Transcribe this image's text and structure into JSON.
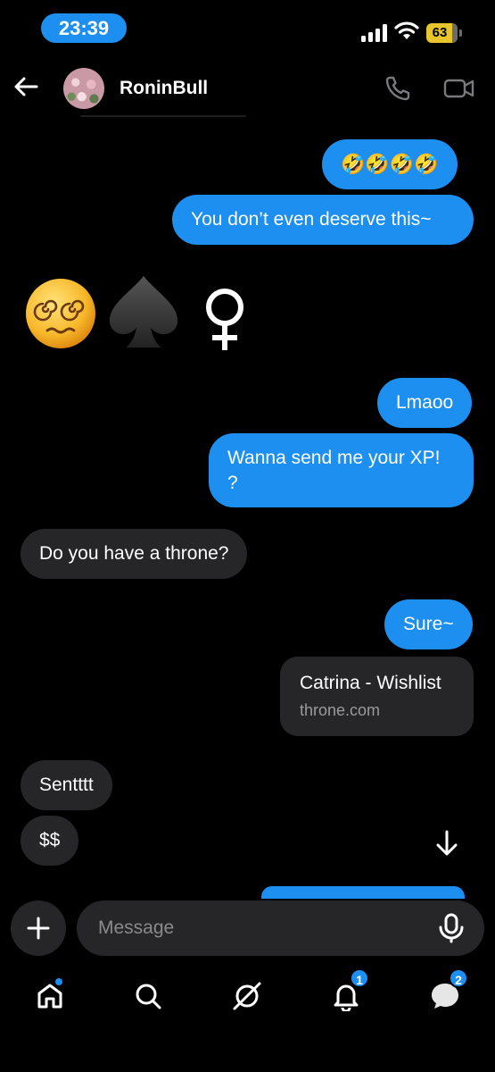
{
  "status_bar": {
    "time": "23:39",
    "battery": "63"
  },
  "header": {
    "contact_name": "RoninBull",
    "icons": [
      "back-arrow-icon",
      "phone-icon",
      "video-camera-icon"
    ]
  },
  "messages": [
    {
      "side": "sent",
      "text": "🤣🤣🤣🤣"
    },
    {
      "side": "sent",
      "text": "You don’t even deserve this~"
    },
    {
      "side": "received",
      "type": "emoji",
      "text": "😵‍💫♠️♀"
    },
    {
      "side": "sent",
      "text": "Lmaoo"
    },
    {
      "side": "sent",
      "text": "Wanna send me your XP!\n?"
    },
    {
      "side": "received",
      "text": "Do you have a throne?"
    },
    {
      "side": "sent",
      "text": "Sure~"
    },
    {
      "side": "sent",
      "type": "link",
      "title": "Catrina - Wishlist",
      "domain": "throne.com"
    },
    {
      "side": "received",
      "text": "Sentttt"
    },
    {
      "side": "received",
      "text": "$$"
    }
  ],
  "composer": {
    "placeholder": "Message"
  },
  "bottom_nav": {
    "items": [
      "home-icon",
      "search-icon",
      "grok-icon",
      "notifications-icon",
      "messages-icon"
    ],
    "notifications_badge": "1",
    "messages_badge": "2"
  },
  "colors": {
    "accent": "#1d8ff0",
    "bubble_received": "#262628",
    "background": "#000000"
  }
}
